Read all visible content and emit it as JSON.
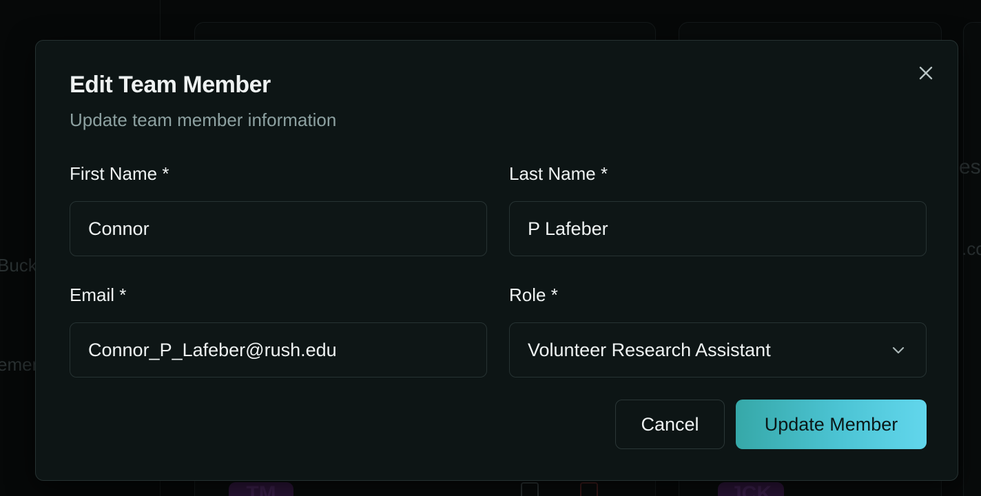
{
  "background": {
    "fragments": [
      "Buck",
      "emen",
      "es",
      ".co",
      "TM",
      "JCK"
    ]
  },
  "dialog": {
    "title": "Edit Team Member",
    "subtitle": "Update team member information",
    "close_icon": "close-icon",
    "fields": {
      "first_name": {
        "label": "First Name *",
        "value": "Connor"
      },
      "last_name": {
        "label": "Last Name *",
        "value": "P Lafeber"
      },
      "email": {
        "label": "Email *",
        "value": "Connor_P_Lafeber@rush.edu"
      },
      "role": {
        "label": "Role *",
        "value": "Volunteer Research Assistant",
        "icon": "chevron-down-icon"
      }
    },
    "buttons": {
      "cancel": "Cancel",
      "update": "Update Member"
    }
  },
  "colors": {
    "dialog_bg": "#0d1515",
    "accent_start": "#36a8a8",
    "accent_end": "#62d6ec",
    "text_primary": "#eef2f2",
    "text_muted": "#8da1a1"
  }
}
